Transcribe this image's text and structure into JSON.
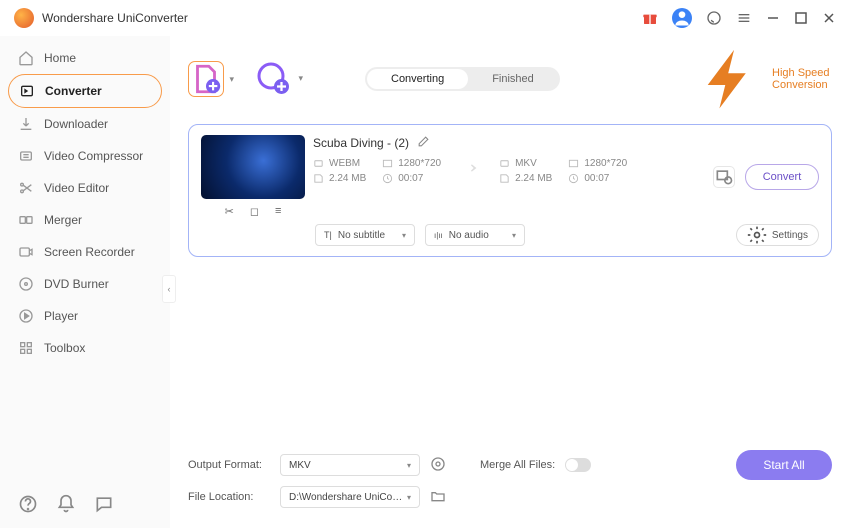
{
  "title": "Wondershare UniConverter",
  "sidebar": {
    "items": [
      {
        "label": "Home"
      },
      {
        "label": "Converter"
      },
      {
        "label": "Downloader"
      },
      {
        "label": "Video Compressor"
      },
      {
        "label": "Video Editor"
      },
      {
        "label": "Merger"
      },
      {
        "label": "Screen Recorder"
      },
      {
        "label": "DVD Burner"
      },
      {
        "label": "Player"
      },
      {
        "label": "Toolbox"
      }
    ]
  },
  "tabs": {
    "converting": "Converting",
    "finished": "Finished"
  },
  "speed_label": "High Speed Conversion",
  "file": {
    "name": "Scuba Diving - (2)",
    "src": {
      "format": "WEBM",
      "res": "1280*720",
      "size": "2.24 MB",
      "dur": "00:07"
    },
    "dst": {
      "format": "MKV",
      "res": "1280*720",
      "size": "2.24 MB",
      "dur": "00:07"
    },
    "convert_btn": "Convert",
    "subtitle": "No subtitle",
    "audio": "No audio",
    "settings": "Settings"
  },
  "footer": {
    "output_label": "Output Format:",
    "output_value": "MKV",
    "merge_label": "Merge All Files:",
    "location_label": "File Location:",
    "location_value": "D:\\Wondershare UniConverter",
    "start": "Start All"
  }
}
